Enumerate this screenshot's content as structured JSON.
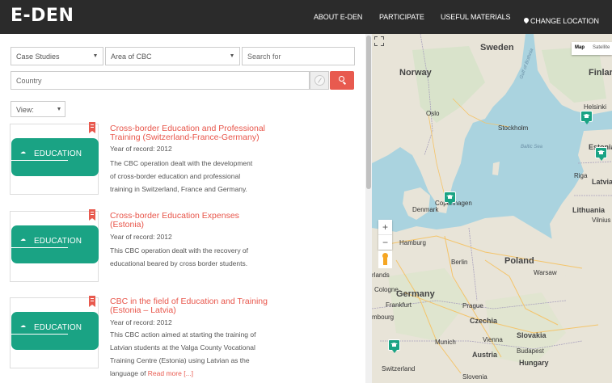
{
  "header": {
    "logo": "E-DEN",
    "nav": [
      "ABOUT E-DEN",
      "PARTICIPATE",
      "USEFUL MATERIALS",
      "CHANGE LOCATION"
    ]
  },
  "filters": {
    "category": "Case Studies",
    "area": "Area of CBC",
    "search_placeholder": "Search for",
    "country_placeholder": "Country",
    "view": "View:"
  },
  "results": [
    {
      "title": [
        "Cross-border Education and Professional",
        "Training (Switzerland-France-Germany)"
      ],
      "year": "Year of record: 2012",
      "desc": [
        "The CBC operation dealt with the development",
        "of cross-border education and professional",
        "training in Switzerland, France and Germany."
      ],
      "badge": "EDUCATION"
    },
    {
      "title": [
        "Cross-border Education Expenses",
        "(Estonia)"
      ],
      "year": "Year of record: 2012",
      "desc": [
        "This CBC operation dealt with the recovery of",
        "educational beared by cross border students."
      ],
      "badge": "EDUCATION"
    },
    {
      "title": [
        "CBC in the field of Education and Training",
        "(Estonia – Latvia)"
      ],
      "year": "Year of record: 2012",
      "desc": [
        "This CBC action aimed at starting the training of",
        "Latvian students at the Valga County Vocational",
        "Training Centre (Estonia) using Latvian as the",
        "language of "
      ],
      "read_more": "Read more [...]",
      "badge": "EDUCATION"
    }
  ],
  "map": {
    "type_options": [
      "Map",
      "Satellite"
    ],
    "zoom_in": "+",
    "zoom_out": "−",
    "labels": {
      "sweden": "Sweden",
      "norway": "Norway",
      "finland": "Finlar",
      "oslo": "Oslo",
      "helsinki": "Helsinki",
      "stockholm": "Stockholm",
      "estonia": "Estonia",
      "baltic": "Baltic Sea",
      "gulf": "Gulf of Bothnia",
      "riga": "Riga",
      "latvia": "Latvia",
      "denmark": "Denmark",
      "copenhagen": "Copenhagen",
      "lithuania": "Lithuania",
      "vilnius": "Vilnius",
      "hamburg": "Hamburg",
      "berlin": "Berlin",
      "poland": "Poland",
      "warsaw": "Warsaw",
      "germany": "Germany",
      "cologne": "Cologne",
      "frankfurt": "Frankfurt",
      "prague": "Prague",
      "czechia": "Czechia",
      "munich": "Munich",
      "vienna": "Vienna",
      "slovakia": "Slovakia",
      "austria": "Austria",
      "budapest": "Budapest",
      "hungary": "Hungary",
      "switzerland": "Switzerland",
      "slovenia": "Slovenia",
      "lands": "rlands",
      "bourg": "mbourg"
    },
    "colors": {
      "water": "#aad3df",
      "land": "#e8e4d8",
      "marker": "#1aa384"
    }
  }
}
